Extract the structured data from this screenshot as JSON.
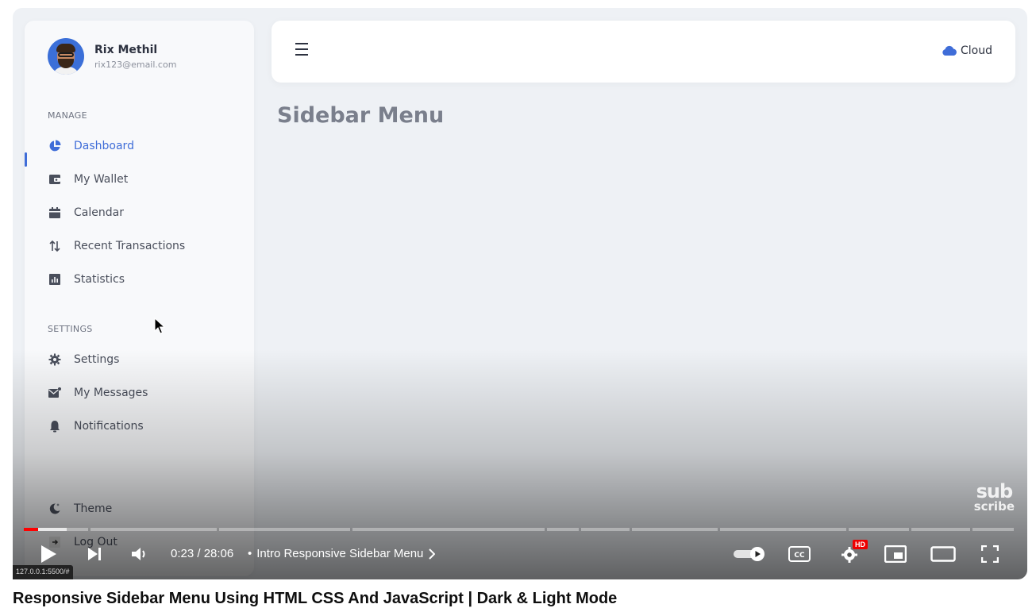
{
  "profile": {
    "name": "Rix Methil",
    "email": "rix123@email.com"
  },
  "sidebar": {
    "manage_label": "MANAGE",
    "settings_label": "SETTINGS",
    "manage_items": [
      {
        "label": "Dashboard",
        "icon": "pie-chart-icon",
        "active": true
      },
      {
        "label": "My Wallet",
        "icon": "wallet-icon"
      },
      {
        "label": "Calendar",
        "icon": "calendar-icon"
      },
      {
        "label": "Recent Transactions",
        "icon": "transfer-arrows-icon"
      },
      {
        "label": "Statistics",
        "icon": "bar-chart-icon"
      }
    ],
    "settings_items": [
      {
        "label": "Settings",
        "icon": "gear-icon"
      },
      {
        "label": "My Messages",
        "icon": "envelope-icon"
      },
      {
        "label": "Notifications",
        "icon": "bell-icon"
      }
    ],
    "bottom_items": [
      {
        "label": "Theme",
        "icon": "moon-icon"
      },
      {
        "label": "Log Out",
        "icon": "logout-icon"
      }
    ]
  },
  "topbar": {
    "brand": "Cloud"
  },
  "page": {
    "title": "Sidebar Menu"
  },
  "player": {
    "time": "0:23 / 28:06",
    "chapter": "Intro Responsive Sidebar Menu",
    "hd_badge": "HD",
    "watermark_top": "sub",
    "watermark_bottom": "scribe",
    "status_url": "127.0.0.1:5500/#",
    "video_title": "Responsive Sidebar Menu Using HTML CSS And JavaScript | Dark & Light Mode"
  },
  "colors": {
    "accent": "#3f6dd8",
    "progress": "#ff0000"
  }
}
